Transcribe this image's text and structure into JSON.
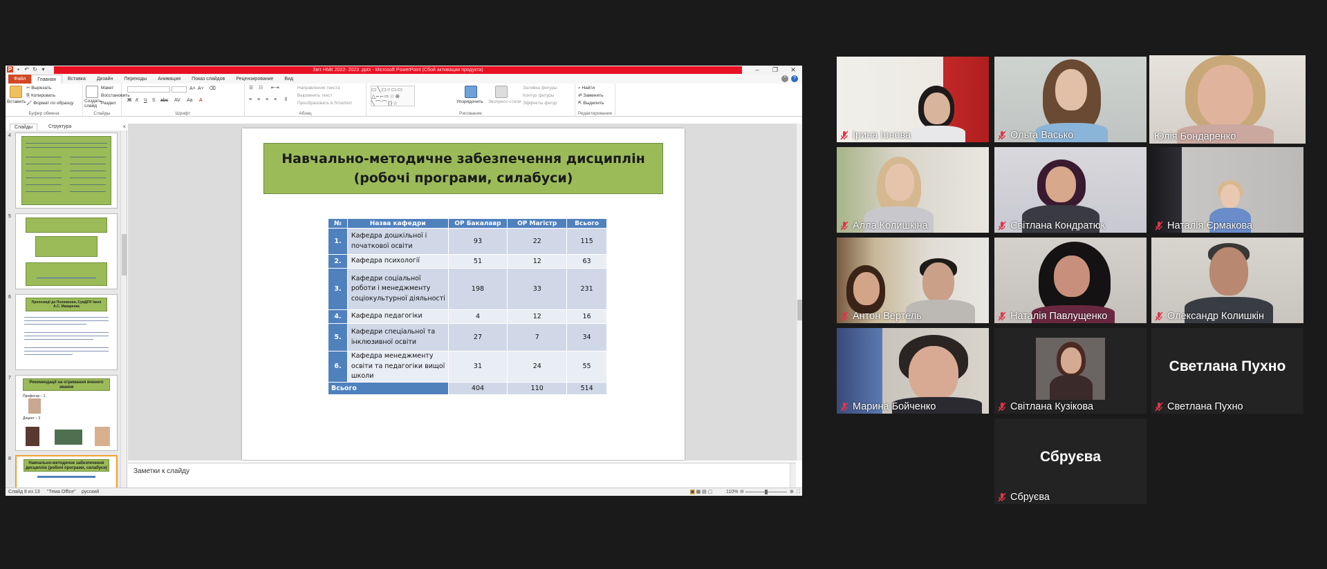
{
  "window": {
    "title": "Звіт НМК 2022- 2023 .pptx - Microsoft PowerPoint (Сбой активации продукта)",
    "controls": [
      "–",
      "❐",
      "✕"
    ]
  },
  "ribbon": {
    "tabs": [
      "Файл",
      "Главная",
      "Вставка",
      "Дизайн",
      "Переходы",
      "Анимация",
      "Показ слайдов",
      "Рецензирование",
      "Вид"
    ],
    "active_tab": "Главная",
    "clipboard": {
      "paste": "Вставить",
      "cut": "Вырезать",
      "copy": "Копировать",
      "format": "Формат по образцу",
      "label": "Буфер обмена"
    },
    "slides": {
      "new": "Создать слайд",
      "layout": "Макет",
      "reset": "Восстановить",
      "section": "Раздел",
      "label": "Слайды"
    },
    "font": {
      "label": "Шрифт"
    },
    "paragraph": {
      "direction": "Направление текста",
      "align": "Выровнять текст",
      "smartart": "Преобразовать в SmartArt",
      "label": "Абзац"
    },
    "drawing": {
      "arrange": "Упорядочить",
      "styles": "Экспресс-стили",
      "fill": "Заливка фигуры",
      "outline": "Контур фигуры",
      "effects": "Эффекты фигур",
      "label": "Рисование"
    },
    "editing": {
      "find": "Найти",
      "replace": "Заменить",
      "select": "Выделить",
      "label": "Редактирование"
    }
  },
  "panel": {
    "tabs": [
      "Слайды",
      "Структура"
    ],
    "close": "×",
    "slides": [
      {
        "num": "4",
        "title": ""
      },
      {
        "num": "5",
        "title": ""
      },
      {
        "num": "6",
        "title": "Пропозиції до Положення, СумДПУ імені А.С. Макаренка"
      },
      {
        "num": "7",
        "title": "Рекомендації на отримання вченого звання"
      },
      {
        "num": "8",
        "title": "Навчально-методичне забезпечення дисциплін (робочі програми, силабуси)"
      }
    ],
    "slide7": {
      "prof": "Професор – 1",
      "doc": "Доцент – 3"
    }
  },
  "slide": {
    "title_line1": "Навчально-методичне забезпечення дисциплін",
    "title_line2": "(робочі програми, силабуси)",
    "table": {
      "headers": [
        "№",
        "Назва кафедри",
        "ОР Бакалавр",
        "ОР Магістр",
        "Всього"
      ],
      "rows": [
        {
          "num": "1.",
          "name": "Кафедра дошкільної і початкової освіти",
          "bach": "93",
          "mag": "22",
          "total": "115"
        },
        {
          "num": "2.",
          "name": "Кафедра психології",
          "bach": "51",
          "mag": "12",
          "total": "63"
        },
        {
          "num": "3.",
          "name": "Кафедри соціальної роботи і менеджменту соціокультурної діяльності",
          "bach": "198",
          "mag": "33",
          "total": "231"
        },
        {
          "num": "4.",
          "name": "Кафедра педагогіки",
          "bach": "4",
          "mag": "12",
          "total": "16"
        },
        {
          "num": "5.",
          "name": "Кафедри спеціальної та інклюзивної освіти",
          "bach": "27",
          "mag": "7",
          "total": "34"
        },
        {
          "num": "6.",
          "name": "Кафедра менеджменту освіти та педагогіки вищої школи",
          "bach": "31",
          "mag": "24",
          "total": "55"
        }
      ],
      "total_row": {
        "label": "Всього",
        "bach": "404",
        "mag": "110",
        "total": "514"
      }
    }
  },
  "notes": {
    "placeholder": "Заметки к слайду"
  },
  "statusbar": {
    "slide": "Слайд 8 из 13",
    "theme": "\"Тема Office\"",
    "lang": "русский",
    "zoom": "110%"
  },
  "participants": [
    {
      "name": "Ірина Іонова",
      "muted": true,
      "video": true
    },
    {
      "name": "Ольга Васько",
      "muted": true,
      "video": true
    },
    {
      "name": "Юлія Бондаренко",
      "muted": false,
      "video": true,
      "speaking": true
    },
    {
      "name": "Алла Колишкіна",
      "muted": true,
      "video": true
    },
    {
      "name": "Світлана Кондратюк",
      "muted": true,
      "video": true
    },
    {
      "name": "Наталія  Єрмакова",
      "muted": true,
      "video": true
    },
    {
      "name": "Антон Вертель",
      "muted": true,
      "video": true
    },
    {
      "name": "Наталія Павлущенко",
      "muted": true,
      "video": true
    },
    {
      "name": "Олександр Колишкін",
      "muted": true,
      "video": true
    },
    {
      "name": "Марина Бойченко",
      "muted": true,
      "video": true
    },
    {
      "name": "Світлана Кузікова",
      "muted": true,
      "video": false,
      "avatar": true
    },
    {
      "name": "Светлана Пухно",
      "muted": true,
      "video": false,
      "display_name": "Светлана Пухно"
    },
    {
      "name": "Сбруєва",
      "muted": true,
      "video": false,
      "display_name": "Сбруєва"
    }
  ],
  "colors": {
    "accent_green": "#9bbb59",
    "table_blue": "#4f81bd",
    "title_red": "#e81123",
    "speaker_outline": "#c8e05a",
    "mic_red": "#e0364c"
  }
}
